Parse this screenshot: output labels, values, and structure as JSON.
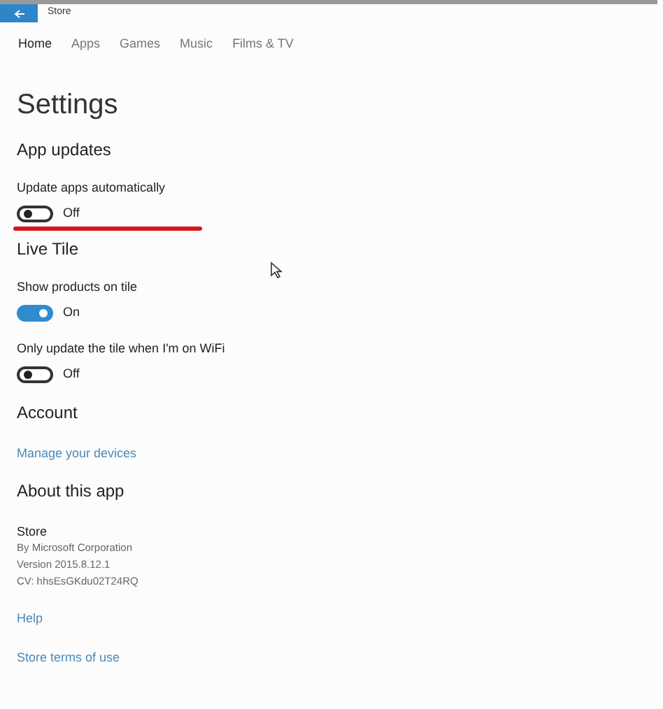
{
  "window": {
    "title": "Store"
  },
  "tabs": [
    {
      "label": "Home",
      "selected": true
    },
    {
      "label": "Apps",
      "selected": false
    },
    {
      "label": "Games",
      "selected": false
    },
    {
      "label": "Music",
      "selected": false
    },
    {
      "label": "Films & TV",
      "selected": false
    }
  ],
  "heading": "Settings",
  "sections": [
    {
      "title": "App updates",
      "items": [
        {
          "kind": "toggle",
          "label": "Update apps automatically",
          "on": false,
          "state_text": "Off",
          "underlined": true
        }
      ]
    },
    {
      "title": "Live Tile",
      "items": [
        {
          "kind": "toggle",
          "label": "Show products on tile",
          "on": true,
          "state_text": "On",
          "underlined": false
        },
        {
          "kind": "toggle",
          "label": "Only update the tile when I'm on WiFi",
          "on": false,
          "state_text": "Off",
          "underlined": false
        }
      ]
    },
    {
      "title": "Account",
      "items": [
        {
          "kind": "link",
          "label": "Manage your devices"
        }
      ]
    },
    {
      "title": "About this app",
      "items": [
        {
          "kind": "info",
          "lines": [
            "Store",
            "By Microsoft Corporation",
            "Version 2015.8.12.1",
            "CV: hhsEsGKdu02T24RQ"
          ]
        },
        {
          "kind": "link",
          "label": "Help"
        },
        {
          "kind": "link",
          "label": "Store terms of use"
        }
      ]
    }
  ]
}
